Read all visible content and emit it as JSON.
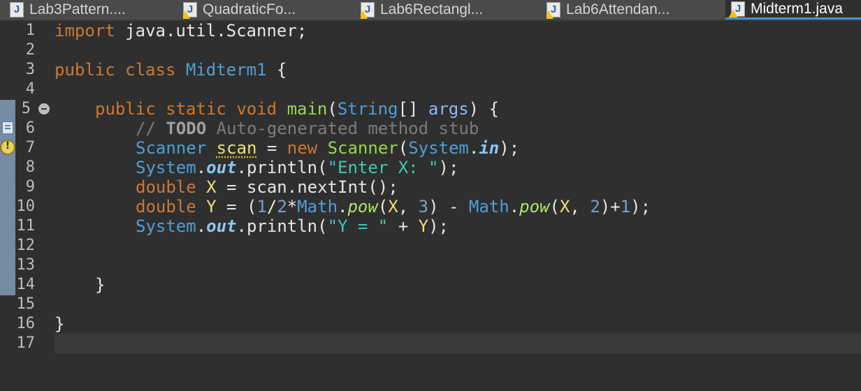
{
  "tabs": [
    {
      "label": "Lab3Pattern....",
      "warning": false,
      "active": false
    },
    {
      "label": "QuadraticFo...",
      "warning": true,
      "active": false
    },
    {
      "label": "Lab6Rectangl...",
      "warning": true,
      "active": false
    },
    {
      "label": "Lab6Attendan...",
      "warning": true,
      "active": false
    },
    {
      "label": "Midterm1.java",
      "warning": true,
      "active": true
    }
  ],
  "editor": {
    "line_numbers": [
      "1",
      "2",
      "3",
      "4",
      "5",
      "6",
      "7",
      "8",
      "9",
      "10",
      "11",
      "12",
      "13",
      "14",
      "15",
      "16",
      "17"
    ],
    "current_line": 17,
    "code": {
      "l1_kw": "import",
      "l1_rest": " java.util.Scanner;",
      "l3_kw1": "public",
      "l3_kw2": "class",
      "l3_name": "Midterm1",
      "l3_brace": " {",
      "l5_kw1": "public",
      "l5_kw2": "static",
      "l5_kw3": "void",
      "l5_method": "main",
      "l5_open": "(",
      "l5_type": "String",
      "l5_arr": "[] ",
      "l5_param": "args",
      "l5_close": ") {",
      "l6_comment": "// ",
      "l6_todo": "TODO",
      "l6_rest": " Auto-generated method stub",
      "l7_type": "Scanner",
      "l7_var": "scan",
      "l7_eq": " = ",
      "l7_new": "new",
      "l7_ctor": "Scanner",
      "l7_open": "(",
      "l7_sys": "System",
      "l7_dot": ".",
      "l7_in": "in",
      "l7_close": ");",
      "l8_sys": "System",
      "l8_dot1": ".",
      "l8_out": "out",
      "l8_call": ".println(",
      "l8_str": "\"Enter X: \"",
      "l8_end": ");",
      "l9_kw": "double",
      "l9_var": "X",
      "l9_eq": " = scan.nextInt();",
      "l10_kw": "double",
      "l10_var": "Y",
      "l10_a": " = (",
      "l10_n1": "1",
      "l10_b": "/",
      "l10_n2": "2",
      "l10_c": "*",
      "l10_math1": "Math",
      "l10_d": ".",
      "l10_pow1": "pow",
      "l10_e": "(",
      "l10_x1": "X",
      "l10_f": ", ",
      "l10_n3": "3",
      "l10_g": ") - ",
      "l10_math2": "Math",
      "l10_h": ".",
      "l10_pow2": "pow",
      "l10_i": "(",
      "l10_x2": "X",
      "l10_j": ", ",
      "l10_n4": "2",
      "l10_k": ")+",
      "l10_n5": "1",
      "l10_l": ");",
      "l11_sys": "System",
      "l11_dot1": ".",
      "l11_out": "out",
      "l11_call": ".println(",
      "l11_str": "\"Y = \"",
      "l11_plus": " + ",
      "l11_var": "Y",
      "l11_end": ");",
      "l14": "}",
      "l16": "}"
    }
  },
  "colors": {
    "background": "#2f2f2f",
    "keyword": "#cc7832",
    "class": "#4f9fd6",
    "method": "#9bd450",
    "string": "#3fc8b5",
    "number": "#7d9ec8",
    "variable": "#e8e07a",
    "comment": "#7c7c7c",
    "active_tab_underline": "#4a90d9"
  },
  "icons": {
    "tab_file": "java-file-icon",
    "tab_warning": "warning-icon",
    "fold": "collapse-icon",
    "gutter_task": "task-marker-icon",
    "gutter_warning": "warning-marker-icon"
  }
}
